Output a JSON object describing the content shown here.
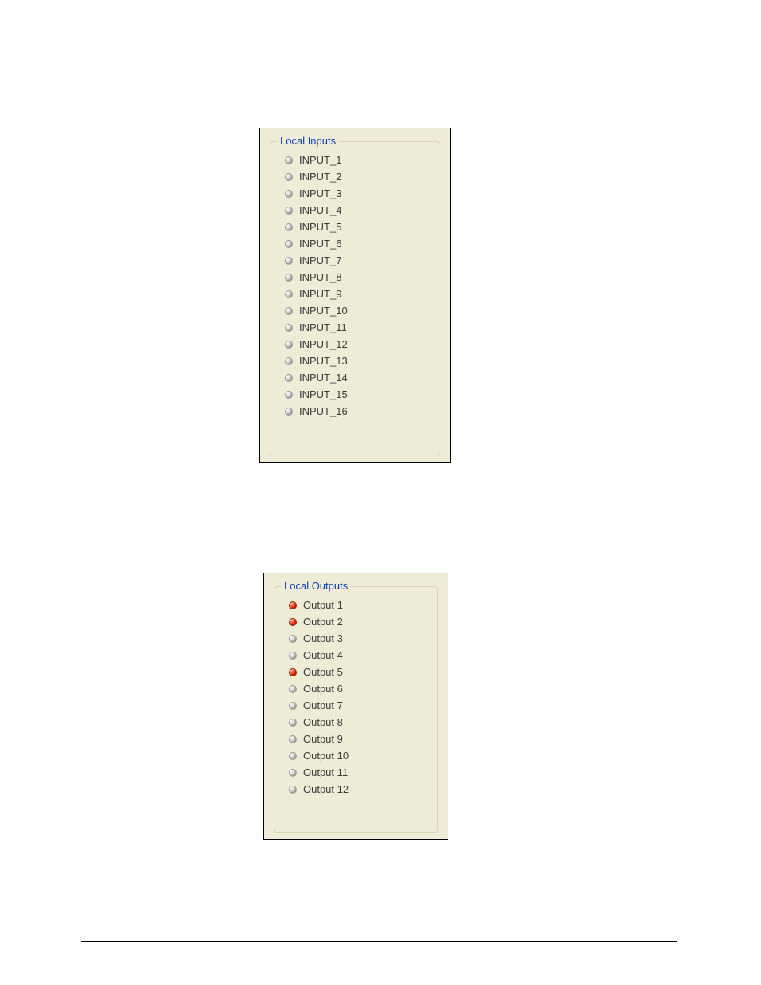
{
  "inputs": {
    "title": "Local Inputs",
    "items": [
      {
        "label": "INPUT_1",
        "on": false
      },
      {
        "label": "INPUT_2",
        "on": false
      },
      {
        "label": "INPUT_3",
        "on": false
      },
      {
        "label": "INPUT_4",
        "on": false
      },
      {
        "label": "INPUT_5",
        "on": false
      },
      {
        "label": "INPUT_6",
        "on": false
      },
      {
        "label": "INPUT_7",
        "on": false
      },
      {
        "label": "INPUT_8",
        "on": false
      },
      {
        "label": "INPUT_9",
        "on": false
      },
      {
        "label": "INPUT_10",
        "on": false
      },
      {
        "label": "INPUT_11",
        "on": false
      },
      {
        "label": "INPUT_12",
        "on": false
      },
      {
        "label": "INPUT_13",
        "on": false
      },
      {
        "label": "INPUT_14",
        "on": false
      },
      {
        "label": "INPUT_15",
        "on": false
      },
      {
        "label": "INPUT_16",
        "on": false
      }
    ]
  },
  "outputs": {
    "title": "Local Outputs",
    "items": [
      {
        "label": "Output 1",
        "on": true
      },
      {
        "label": "Output 2",
        "on": true
      },
      {
        "label": "Output 3",
        "on": false
      },
      {
        "label": "Output 4",
        "on": false
      },
      {
        "label": "Output 5",
        "on": true
      },
      {
        "label": "Output 6",
        "on": false
      },
      {
        "label": "Output 7",
        "on": false
      },
      {
        "label": "Output 8",
        "on": false
      },
      {
        "label": "Output 9",
        "on": false
      },
      {
        "label": "Output 10",
        "on": false
      },
      {
        "label": "Output 11",
        "on": false
      },
      {
        "label": "Output 12",
        "on": false
      }
    ]
  }
}
